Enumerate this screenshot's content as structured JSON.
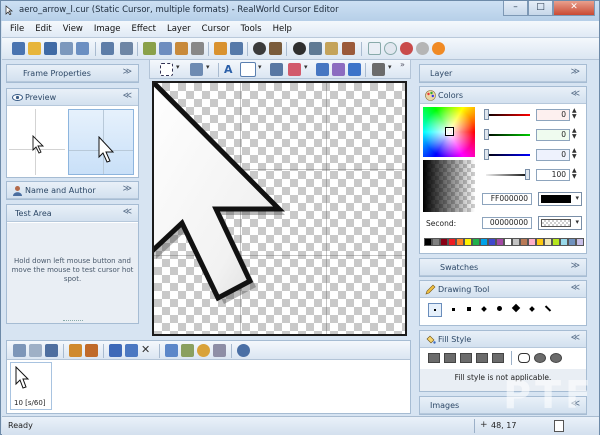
{
  "window": {
    "title": "aero_arrow_l.cur (Static Cursor, multiple formats) - RealWorld Cursor Editor"
  },
  "menu": [
    "File",
    "Edit",
    "View",
    "Image",
    "Effect",
    "Layer",
    "Cursor",
    "Tools",
    "Help"
  ],
  "left_panels": {
    "frame_properties": "Frame Properties",
    "preview": "Preview",
    "name_and_author": "Name and Author",
    "test_area": "Test Area",
    "test_area_hint": "Hold down left mouse button and move the mouse to test cursor hot spot."
  },
  "right_panels": {
    "layer": "Layer",
    "colors": "Colors",
    "swatches": "Swatches",
    "drawing_tool": "Drawing Tool",
    "fill_style": "Fill Style",
    "fill_style_message": "Fill style is not applicable.",
    "images": "Images"
  },
  "colors": {
    "rgb_values": [
      "0",
      "0",
      "0"
    ],
    "alpha_value": "100",
    "primary_hex": "FF000000",
    "second_label": "Second:",
    "second_hex": "00000000",
    "palette": [
      "#000000",
      "#7f7f7f",
      "#880015",
      "#ed1c24",
      "#ff7f27",
      "#fff200",
      "#22b14c",
      "#00a2e8",
      "#3f48cc",
      "#a349a4",
      "#ffffff",
      "#c3c3c3",
      "#b97a57",
      "#ffaec9",
      "#ffc90e",
      "#efe4b0",
      "#b5e61d",
      "#99d9ea",
      "#7092be",
      "#c8bfe7"
    ]
  },
  "frames": {
    "frame_label": "10 [s/60]"
  },
  "status": {
    "left": "Ready",
    "coords": "48, 17"
  },
  "watermark": "PTF"
}
